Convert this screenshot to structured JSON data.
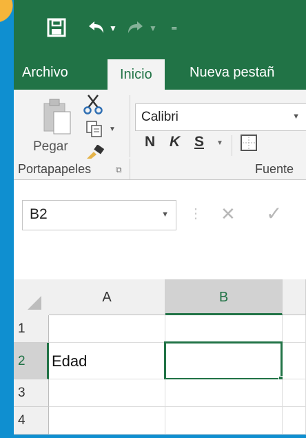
{
  "qat": {
    "save_icon": "save-icon",
    "undo_icon": "undo-icon",
    "redo_icon": "redo-icon",
    "customize_icon": "customize-qat-icon"
  },
  "tabs": [
    {
      "label": "Archivo"
    },
    {
      "label": "Inicio"
    },
    {
      "label": "Nueva pestañ"
    }
  ],
  "ribbon": {
    "clipboard": {
      "paste_label": "Pegar",
      "group_label": "Portapapeles"
    },
    "font": {
      "font_name": "Calibri",
      "bold": "N",
      "italic": "K",
      "underline": "S",
      "group_label": "Fuente"
    }
  },
  "formula_bar": {
    "name_box": "B2",
    "cancel_symbol": "✕",
    "enter_symbol": "✓"
  },
  "sheet": {
    "columns": [
      "A",
      "B"
    ],
    "rows": [
      "1",
      "2",
      "3",
      "4"
    ],
    "cells": {
      "A2": "Edad"
    },
    "active_cell": "B2"
  },
  "colors": {
    "accent": "#217346",
    "background": "#0f8fd0"
  }
}
